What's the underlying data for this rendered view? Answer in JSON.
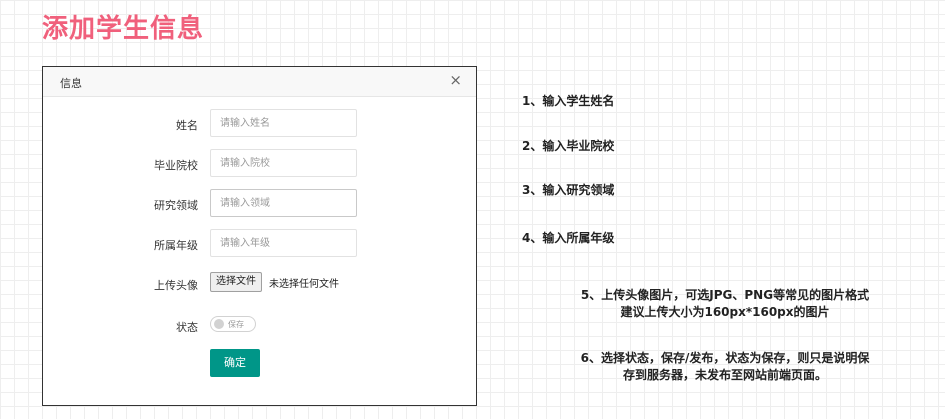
{
  "page_title": "添加学生信息",
  "dialog": {
    "title": "信息",
    "close_symbol": "×",
    "fields": [
      {
        "label": "姓名",
        "placeholder": "请输入姓名"
      },
      {
        "label": "毕业院校",
        "placeholder": "请输入院校"
      },
      {
        "label": "研究领域",
        "placeholder": "请输入领域"
      },
      {
        "label": "所属年级",
        "placeholder": "请输入年级"
      }
    ],
    "upload": {
      "label": "上传头像",
      "button": "选择文件",
      "status": "未选择任何文件"
    },
    "status": {
      "label": "状态",
      "switch_text": "保存"
    },
    "confirm": "确定"
  },
  "steps": [
    "1、输入学生姓名",
    "2、输入毕业院校",
    "3、输入研究领域",
    "4、输入所属年级",
    "5、上传头像图片，可选JPG、PNG等常见的图片格式",
    "建议上传大小为160px*160px的图片",
    "6、选择状态，保存/发布，状态为保存，则只是说明保",
    "存到服务器，未发布至网站前端页面。"
  ],
  "colors": {
    "title": "#f0607c",
    "primary_button": "#009688"
  }
}
